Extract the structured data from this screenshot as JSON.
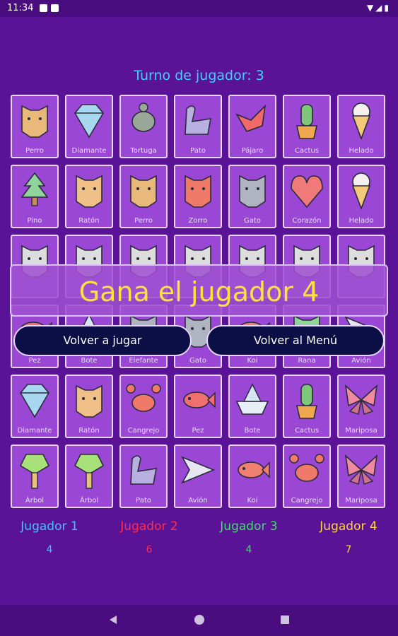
{
  "status_bar": {
    "time": "11:34"
  },
  "turn": {
    "text": "Turno de jugador: 3"
  },
  "board": {
    "rows": [
      [
        "Perro",
        "Diamante",
        "Tortuga",
        "Pato",
        "Pájaro",
        "Cactus",
        "Helado"
      ],
      [
        "Pino",
        "Ratón",
        "Perro",
        "Zorro",
        "Gato",
        "Corazón",
        "Helado"
      ],
      [
        "",
        "",
        "",
        "",
        "",
        "",
        ""
      ],
      [
        "Pez",
        "Bote",
        "Elefante",
        "Gato",
        "Koi",
        "Rana",
        "Avión"
      ],
      [
        "Diamante",
        "Ratón",
        "Cangrejo",
        "Pez",
        "Bote",
        "Cactus",
        "Mariposa"
      ],
      [
        "Árbol",
        "Árbol",
        "Pato",
        "Avión",
        "Koi",
        "Cangrejo",
        "Mariposa"
      ]
    ]
  },
  "overlay": {
    "winner_text": "Gana el jugador 4",
    "replay_button": "Volver a jugar",
    "menu_button": "Volver al Menú"
  },
  "players": [
    {
      "name": "Jugador 1",
      "score": "4",
      "color": "#3fc4ff"
    },
    {
      "name": "Jugador 2",
      "score": "6",
      "color": "#ff2e4e"
    },
    {
      "name": "Jugador 3",
      "score": "4",
      "color": "#3ee06a"
    },
    {
      "name": "Jugador 4",
      "score": "7",
      "color": "#ffd43b"
    }
  ],
  "icons": {
    "Perro": "dog-icon",
    "Diamante": "diamond-icon",
    "Tortuga": "turtle-icon",
    "Pato": "swan-icon",
    "Pájaro": "bird-icon",
    "Cactus": "cactus-icon",
    "Helado": "ice-cream-icon",
    "Pino": "pine-tree-icon",
    "Ratón": "mouse-icon",
    "Zorro": "fox-icon",
    "Gato": "cat-icon",
    "Corazón": "heart-icon",
    "Pez": "fish-icon",
    "Bote": "paper-boat-icon",
    "Elefante": "elephant-icon",
    "Koi": "koi-icon",
    "Rana": "frog-icon",
    "Avión": "paper-plane-icon",
    "Cangrejo": "crab-icon",
    "Mariposa": "butterfly-icon",
    "Árbol": "tree-icon"
  }
}
